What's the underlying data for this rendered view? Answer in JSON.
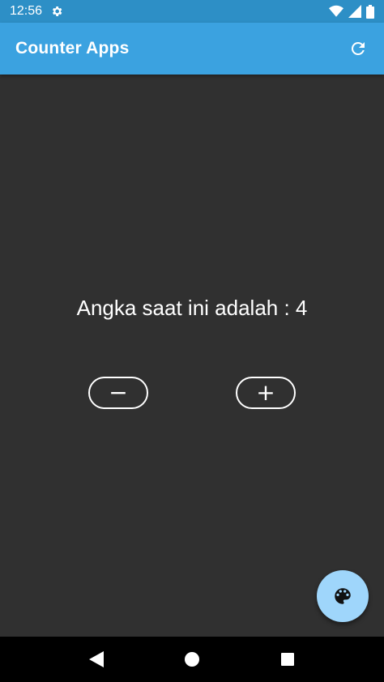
{
  "status_bar": {
    "time": "12:56",
    "icons": [
      "gear-icon",
      "wifi-icon",
      "signal-icon",
      "battery-icon"
    ]
  },
  "app_bar": {
    "title": "Counter Apps",
    "action_icon": "refresh-icon"
  },
  "counter": {
    "label": "Angka saat ini adalah : 4",
    "value": 4,
    "decrement_label": "−",
    "increment_label": "+"
  },
  "fab": {
    "icon": "palette-icon"
  },
  "nav_bar": {
    "icons": [
      "back-icon",
      "home-icon",
      "recents-icon"
    ]
  },
  "colors": {
    "status_bar": "#2d8fc6",
    "app_bar": "#3ba2e0",
    "background": "#303030",
    "fab": "#9fd6fb",
    "nav_bar": "#000000"
  }
}
